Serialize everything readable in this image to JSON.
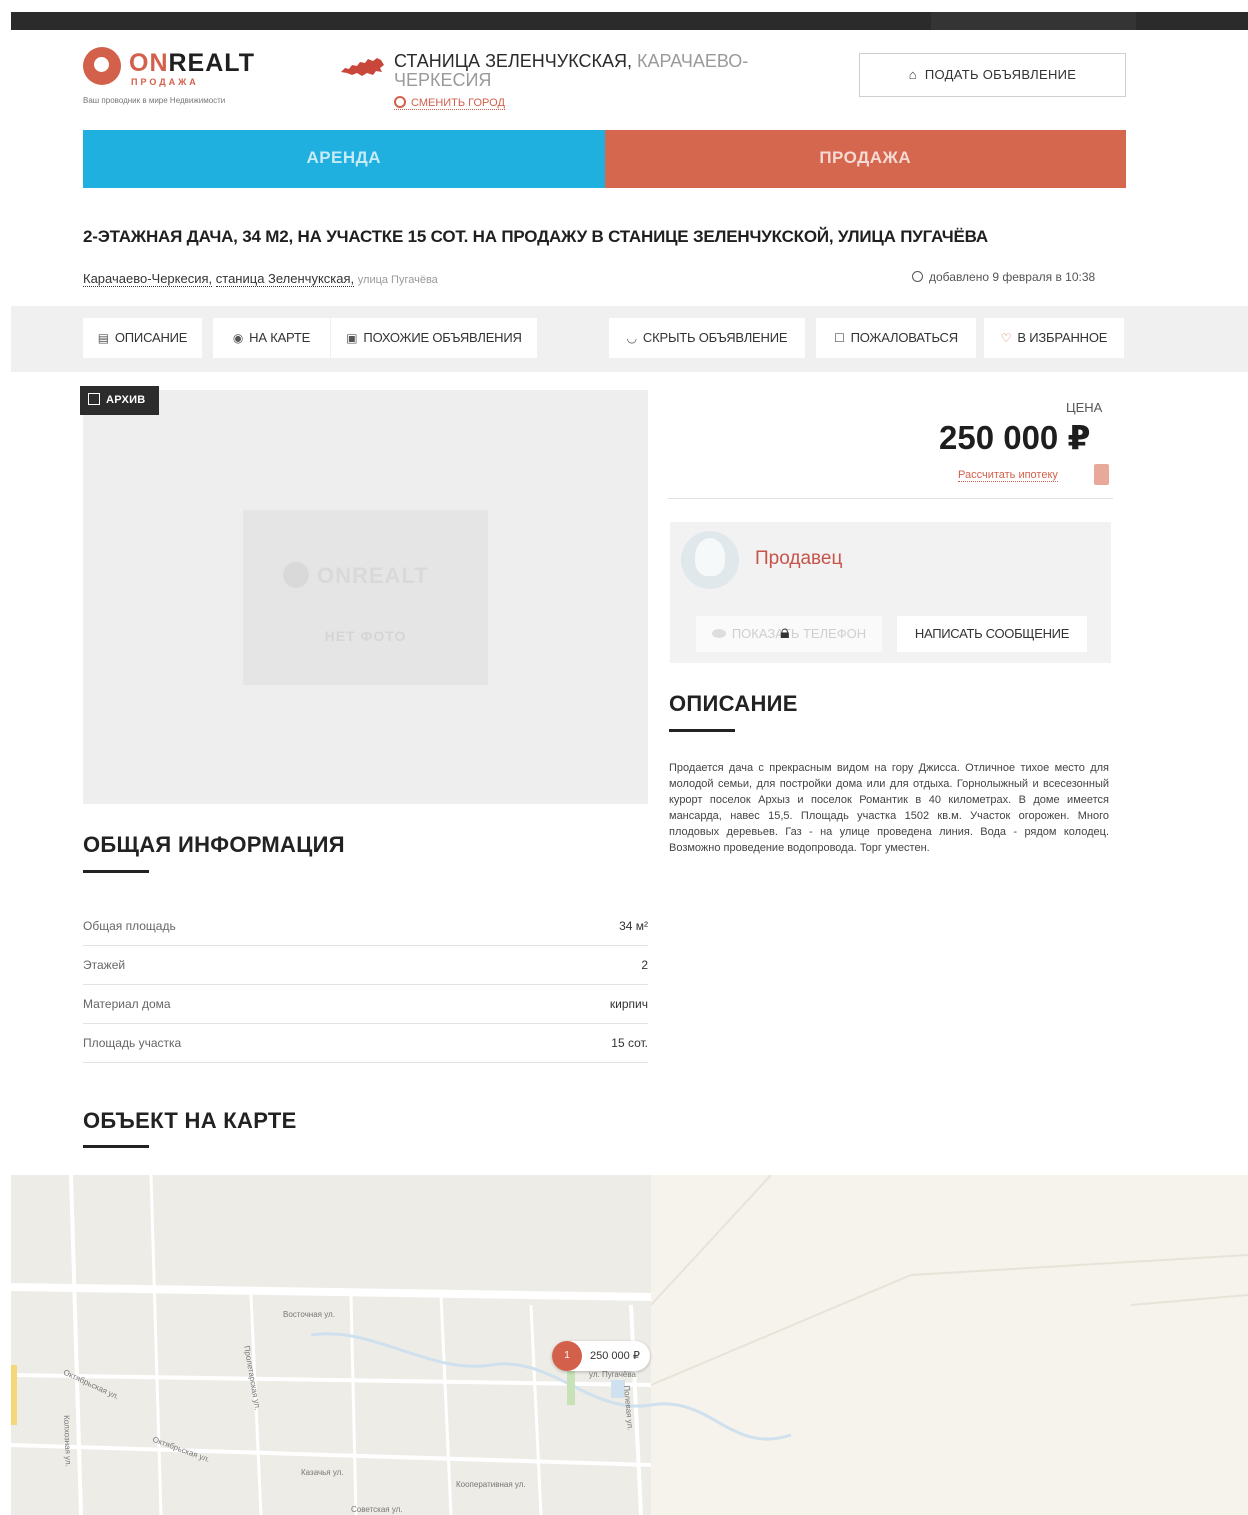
{
  "header": {
    "logo_brand_accent": "ON",
    "logo_brand_rest": "REALT",
    "logo_sub": "ПРОДАЖА",
    "logo_tagline": "Ваш проводник в мире Недвижимости",
    "city_name": "СТАНИЦА ЗЕЛЕНЧУКСКАЯ,",
    "city_region": "КАРАЧАЕВО-ЧЕРКЕСИЯ",
    "change_city": "СМЕНИТЬ ГОРОД",
    "post_ad": "ПОДАТЬ ОБЪЯВЛЕНИЕ"
  },
  "tabs": {
    "rent": "АРЕНДА",
    "sale": "ПРОДАЖА"
  },
  "listing": {
    "title": "2-ЭТАЖНАЯ ДАЧА, 34 М2, НА УЧАСТКЕ 15 СОТ. НА ПРОДАЖУ В СТАНИЦЕ ЗЕЛЕНЧУКСКОЙ, УЛИЦА ПУГАЧЁВА",
    "address_region": "Карачаево-Черкесия,",
    "address_city": "станица Зеленчукская,",
    "address_street": "улица Пугачёва",
    "added": "добавлено 9 февраля в 10:38"
  },
  "actions": {
    "description": "ОПИСАНИЕ",
    "on_map": "НА КАРТЕ",
    "similar": "ПОХОЖИЕ ОБЪЯВЛЕНИЯ",
    "hide": "СКРЫТЬ ОБЪЯВЛЕНИЕ",
    "report": "ПОЖАЛОВАТЬСЯ",
    "favorite": "В ИЗБРАННОЕ"
  },
  "photo": {
    "archive_badge": "АРХИВ",
    "placeholder_logo": "ONREALT",
    "no_photo": "НЕТ ФОТО"
  },
  "price": {
    "label": "ЦЕНА",
    "value": "250 000 ₽",
    "mortgage_link": "Рассчитать ипотеку"
  },
  "seller": {
    "name": "Продавец",
    "show_phone": "ПОКАЗАТЬ ТЕЛЕФОН",
    "write_message": "НАПИСАТЬ СООБЩЕНИЕ"
  },
  "description": {
    "heading": "ОПИСАНИЕ",
    "text": "Продается дача с прекрасным видом на гору Джисса. Отличное тихое место для молодой семьи, для постройки дома или для отдыха. Горнолыжный и всесезонный курорт поселок Архыз и поселок Романтик в 40 километрах. В доме имеется мансарда, навес 15,5. Площадь участка 1502 кв.м. Участок огорожен. Много плодовых деревьев. Газ - на улице проведена линия. Вода - рядом колодец. Возможно проведение водопровода. Торг уместен."
  },
  "info": {
    "heading": "ОБЩАЯ ИНФОРМАЦИЯ",
    "rows": [
      {
        "key": "Общая площадь",
        "value": "34 м²"
      },
      {
        "key": "Этажей",
        "value": "2"
      },
      {
        "key": "Материал дома",
        "value": "кирпич"
      },
      {
        "key": "Площадь участка",
        "value": "15 сот."
      }
    ]
  },
  "map": {
    "heading": "ОБЪЕКТ НА КАРТЕ",
    "marker_count": "1",
    "marker_price": "250 000 ₽",
    "streets": [
      "Восточная ул.",
      "Пролетарская ул.",
      "Октябрьская ул.",
      "Октябрьская ул.",
      "Казачья ул.",
      "Кооперативная ул.",
      "Советская ул.",
      "Полевая ул.",
      "Колхозная ул.",
      "ул. Пугачёва"
    ]
  },
  "colors": {
    "accent": "#d2604b",
    "rent_tab": "#1fb0e0",
    "sale_tab": "#d6674f",
    "dark": "#2b2b2b"
  }
}
